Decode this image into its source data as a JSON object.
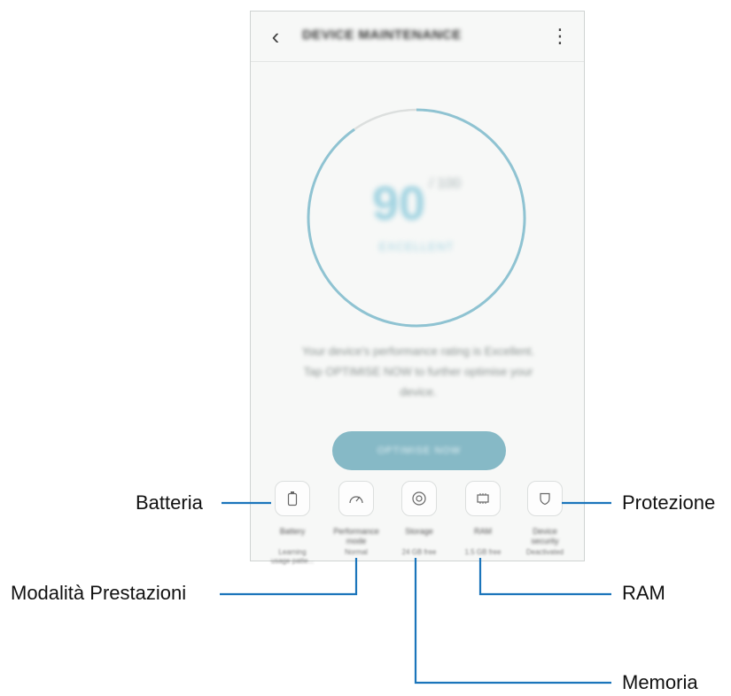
{
  "screen": {
    "title": "DEVICE MAINTENANCE",
    "back_icon": "chevron-left-icon",
    "more_icon": "more-vert-icon"
  },
  "score": {
    "value": "90",
    "unit": "/ 100",
    "status": "EXCELLENT",
    "ring_color": "#8fc3d2"
  },
  "message": {
    "line1": "Your device's performance rating is Excellent.",
    "line2": "Tap OPTIMISE NOW to further optimise your",
    "line3": "device."
  },
  "optimize_button": {
    "label": "OPTIMISE NOW"
  },
  "features": [
    {
      "label_line1": "Battery",
      "label_line2": "",
      "status_line1": "Learning",
      "status_line2": "usage patte...",
      "icon": "battery-icon"
    },
    {
      "label_line1": "Performance",
      "label_line2": "mode",
      "status_line1": "Normal",
      "status_line2": "",
      "icon": "speedometer-icon"
    },
    {
      "label_line1": "Storage",
      "label_line2": "",
      "status_line1": "24 GB free",
      "status_line2": "",
      "icon": "storage-icon"
    },
    {
      "label_line1": "RAM",
      "label_line2": "",
      "status_line1": "1.5 GB free",
      "status_line2": "",
      "icon": "ram-chip-icon"
    },
    {
      "label_line1": "Device",
      "label_line2": "security",
      "status_line1": "Deactivated",
      "status_line2": "",
      "icon": "shield-icon"
    }
  ],
  "callouts": {
    "battery": "Batteria",
    "performance": "Modalità Prestazioni",
    "storage": "Memoria",
    "ram": "RAM",
    "security": "Protezione"
  },
  "leader_color": "#1b75bb"
}
